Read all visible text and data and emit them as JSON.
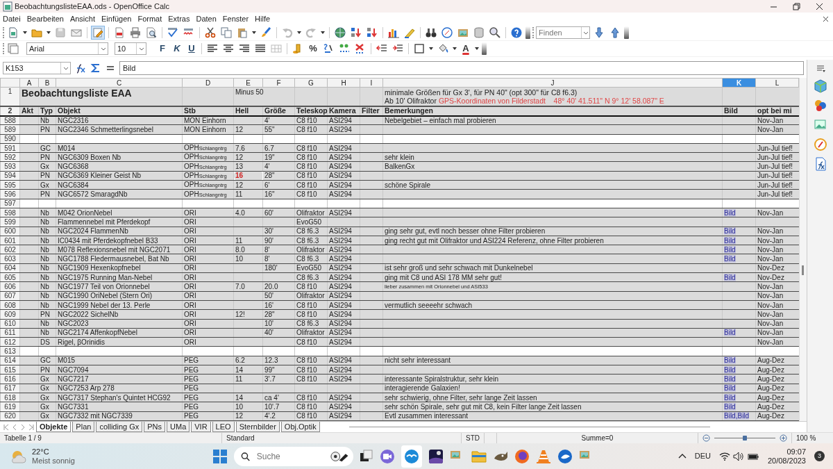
{
  "window": {
    "title": "BeobachtungslisteEAA.ods - OpenOffice Calc"
  },
  "menu": [
    "Datei",
    "Bearbeiten",
    "Ansicht",
    "Einfügen",
    "Format",
    "Extras",
    "Daten",
    "Fenster",
    "Hilfe"
  ],
  "toolbar": {
    "edit_mode": {
      "on": true
    },
    "find": {
      "placeholder": "Finden"
    }
  },
  "format_bar": {
    "font": "Arial",
    "size": "10",
    "text_buttons": [
      "F",
      "K",
      "U"
    ],
    "percent": "%",
    "font_color": "A"
  },
  "formula_bar": {
    "cell": "K153",
    "content": "Bild"
  },
  "columns": [
    {
      "label": "A",
      "selected": false
    },
    {
      "label": "B",
      "selected": false
    },
    {
      "label": "C",
      "selected": false
    },
    {
      "label": "D",
      "selected": false
    },
    {
      "label": "E",
      "selected": false
    },
    {
      "label": "F",
      "selected": false
    },
    {
      "label": "G",
      "selected": false
    },
    {
      "label": "H",
      "selected": false
    },
    {
      "label": "I",
      "selected": false
    },
    {
      "label": "J",
      "selected": false
    },
    {
      "label": "K",
      "selected": true
    },
    {
      "label": "L",
      "selected": false
    }
  ],
  "title_row": {
    "number": "1",
    "title": "Beobachtungsliste EAA",
    "e": "Minus 50",
    "j_lines": [
      [
        {
          "text": "minimale Größen für Gx 3', für PN 40\" (opt 300\" für C8 f6.3)",
          "color": "#222222"
        }
      ],
      [
        {
          "text": "Ab 10' Olifraktor",
          "color": "#222222"
        },
        {
          "text": "GPS-Koordinaten von Filderstadt    48° 40' 41.511\" N 9° 12' 58.087\" E",
          "color": "#e04545"
        }
      ]
    ]
  },
  "header_row": {
    "number": "2",
    "labels": [
      "Akt",
      "Typ",
      "Objekt",
      "Stb",
      "Hell",
      "Größe",
      "Teleskop",
      "Kamera",
      "Filter",
      "Bemerkungen",
      "Bild",
      "opt bei mi"
    ]
  },
  "rows": [
    {
      "number": "588",
      "kind": "data",
      "typ": "Nb",
      "objekt": "NGC2316",
      "stb": "MON Einhorn",
      "groesse": "4'",
      "teleskop": "C8 f10",
      "kamera": "ASI294",
      "bemerkung": "Nebelgebiet – einfach mal probieren",
      "opt": "Nov-Jan",
      "remark_small": false
    },
    {
      "number": "589",
      "kind": "data",
      "typ": "PN",
      "objekt": "NGC2346 Schmetterlingsnebel",
      "stb": "MON Einhorn",
      "hell": "12",
      "groesse": "55\"",
      "teleskop": "C8 f10",
      "kamera": "ASI294",
      "opt": "Nov-Jan",
      "hell_alert": false
    },
    {
      "number": "590",
      "kind": "blank"
    },
    {
      "number": "591",
      "kind": "data",
      "typ": "GC",
      "objekt": "M014",
      "stb": "OPH",
      "stb_sub": "Schlangntrg",
      "hell": "7.6",
      "groesse": "6.7",
      "teleskop": "C8 f10",
      "kamera": "ASI294",
      "opt": "Jun-Jul tief!",
      "hell_alert": false
    },
    {
      "number": "592",
      "kind": "data",
      "typ": "PN",
      "objekt": "NGC6309 Boxen Nb",
      "stb": "OPH",
      "stb_sub": "Schlangntrg",
      "hell": "12",
      "groesse": "19\"",
      "teleskop": "C8 f10",
      "kamera": "ASI294",
      "bemerkung": "sehr klein",
      "opt": "Jun-Jul tief!",
      "hell_alert": false,
      "remark_small": false
    },
    {
      "number": "593",
      "kind": "data",
      "typ": "Gx",
      "objekt": "NGC6368",
      "stb": "OPH",
      "stb_sub": "Schlangntrg",
      "hell": "13",
      "groesse": "4'",
      "teleskop": "C8 f10",
      "kamera": "ASI294",
      "bemerkung": "BalkenGx",
      "opt": "Jun-Jul tief!",
      "hell_alert": false,
      "remark_small": false
    },
    {
      "number": "594",
      "kind": "data",
      "typ": "PN",
      "objekt": "NGC6369 Kleiner Geist Nb",
      "stb": "OPH",
      "stb_sub": "Schlangntrg",
      "hell": "16",
      "groesse": "28\"",
      "teleskop": "C8 f10",
      "kamera": "ASI294",
      "opt": "Jun-Jul tief!",
      "hell_alert": true
    },
    {
      "number": "595",
      "kind": "data",
      "typ": "Gx",
      "objekt": "NGC6384",
      "stb": "OPH",
      "stb_sub": "Schlangntrg",
      "hell": "12",
      "groesse": "6'",
      "teleskop": "C8 f10",
      "kamera": "ASI294",
      "bemerkung": "schöne Spirale",
      "opt": "Jun-Jul tief!",
      "hell_alert": false,
      "remark_small": false
    },
    {
      "number": "596",
      "kind": "data",
      "typ": "PN",
      "objekt": "NGC6572 SmaragdNb",
      "stb": "OPH",
      "stb_sub": "Schlangntrg",
      "hell": "11",
      "groesse": "16\"",
      "teleskop": "C8 f10",
      "kamera": "ASI294",
      "opt": "Jun-Jul tief!",
      "hell_alert": false
    },
    {
      "number": "597",
      "kind": "blank"
    },
    {
      "number": "598",
      "kind": "data",
      "typ": "Nb",
      "objekt": "M042 OrionNebel",
      "stb": "ORI",
      "hell": "4.0",
      "groesse": "60'",
      "teleskop": "Olifraktor",
      "kamera": "ASI294",
      "bild": [
        "Bild"
      ],
      "opt": "Nov-Jan",
      "hell_alert": false
    },
    {
      "number": "599",
      "kind": "data",
      "typ": "Nb",
      "objekt": "Flammennebel mit Pferdekopf",
      "stb": "ORI",
      "teleskop": "EvoG50"
    },
    {
      "number": "600",
      "kind": "data",
      "typ": "Nb",
      "objekt": "NGC2024 FlammenNb",
      "stb": "ORI",
      "groesse": "30'",
      "teleskop": "C8 f6.3",
      "kamera": "ASI294",
      "bemerkung": "ging sehr gut, evtl noch besser ohne Filter probieren",
      "bild": [
        "Bild"
      ],
      "opt": "Nov-Jan",
      "remark_small": false
    },
    {
      "number": "601",
      "kind": "data",
      "typ": "Nb",
      "objekt": "IC0434 mit Pferdekopfnebel B33",
      "stb": "ORI",
      "hell": "11",
      "groesse": "90'",
      "teleskop": "C8 f6.3",
      "kamera": "ASI294",
      "bemerkung": "ging recht gut mit Olifraktor und ASI224 Referenz, ohne Filter probieren",
      "bild": [
        "Bild"
      ],
      "opt": "Nov-Jan",
      "hell_alert": false,
      "remark_small": false
    },
    {
      "number": "602",
      "kind": "data",
      "typ": "Nb",
      "objekt": "M078 Reflexionsnebel mit NGC2071",
      "stb": "ORI",
      "hell": "8.0",
      "groesse": "8'",
      "teleskop": "Olifraktor",
      "kamera": "ASI294",
      "bild": [
        "Bild"
      ],
      "opt": "Nov-Jan",
      "hell_alert": false
    },
    {
      "number": "603",
      "kind": "data",
      "typ": "Nb",
      "objekt": "NGC1788 Fledermausnebel, Bat Nb",
      "stb": "ORI",
      "hell": "10",
      "groesse": "8'",
      "teleskop": "C8 f6.3",
      "kamera": "ASI294",
      "bild": [
        "Bild"
      ],
      "opt": "Nov-Jan",
      "hell_alert": false
    },
    {
      "number": "604",
      "kind": "data",
      "typ": "Nb",
      "objekt": "NGC1909 Hexenkopfnebel",
      "stb": "ORI",
      "groesse": "180'",
      "teleskop": "EvoG50",
      "kamera": "ASI294",
      "bemerkung": "ist sehr groß und sehr schwach mit Dunkelnebel",
      "opt": "Nov-Dez",
      "remark_small": false
    },
    {
      "number": "605",
      "kind": "data",
      "typ": "Nb",
      "objekt": "NGC1975 Running Man-Nebel",
      "stb": "ORI",
      "teleskop": "C8 f6.3",
      "kamera": "ASI294",
      "bemerkung": "ging mit C8 und ASI 178 MM sehr gut!",
      "bild": [
        "Bild"
      ],
      "opt": "Nov-Dez",
      "remark_small": false
    },
    {
      "number": "606",
      "kind": "data",
      "typ": "Nb",
      "objekt": "NGC1977 Teil von Orionnebel",
      "stb": "ORI",
      "hell": "7.0",
      "groesse": "20.0",
      "teleskop": "C8 f10",
      "kamera": "ASI294",
      "bemerkung": "lieber zusammen mit Orionnebel und ASI533",
      "opt": "Nov-Jan",
      "hell_alert": false,
      "remark_small": true
    },
    {
      "number": "607",
      "kind": "data",
      "typ": "Nb",
      "objekt": "NGC1990 OriNebel (Stern Ori)",
      "stb": "ORI",
      "groesse": "50'",
      "teleskop": "Olifraktor",
      "kamera": "ASI294",
      "opt": "Nov-Jan"
    },
    {
      "number": "608",
      "kind": "data",
      "typ": "Nb",
      "objekt": "NGC1999 Nebel der 13. Perle",
      "stb": "ORI",
      "groesse": "16'",
      "teleskop": "C8 f10",
      "kamera": "ASI294",
      "bemerkung": "vermutlich seeeehr schwach",
      "opt": "Nov-Jan",
      "remark_small": false
    },
    {
      "number": "609",
      "kind": "data",
      "typ": "PN",
      "objekt": "NGC2022 SichelNb",
      "stb": "ORI",
      "hell": "12!",
      "groesse": "28\"",
      "teleskop": "C8 f10",
      "kamera": "ASI294",
      "opt": "Nov-Jan",
      "hell_alert": false
    },
    {
      "number": "610",
      "kind": "data",
      "typ": "Nb",
      "objekt": "NGC2023",
      "stb": "ORI",
      "groesse": "10'",
      "teleskop": "C8 f6.3",
      "kamera": "ASI294",
      "opt": "Nov-Jan"
    },
    {
      "number": "611",
      "kind": "data",
      "typ": "Nb",
      "objekt": "NGC2174 AffenkopfNebel",
      "stb": "ORI",
      "groesse": "40'",
      "teleskop": "Olifraktor",
      "kamera": "ASI294",
      "bild": [
        "Bild"
      ],
      "opt": "Nov-Jan"
    },
    {
      "number": "612",
      "kind": "data",
      "typ": "DS",
      "objekt": "Rigel, βOrinidis",
      "stb": "ORI",
      "teleskop": "C8 f10",
      "kamera": "ASI294",
      "opt": "Nov-Jan"
    },
    {
      "number": "613",
      "kind": "blank"
    },
    {
      "number": "614",
      "kind": "data",
      "typ": "GC",
      "objekt": "M015",
      "stb": "PEG",
      "hell": "6.2",
      "groesse": "12.3",
      "teleskop": "C8 f10",
      "kamera": "ASI294",
      "bemerkung": "nicht sehr interessant",
      "bild": [
        "Bild"
      ],
      "opt": "Aug-Dez",
      "hell_alert": false,
      "remark_small": false
    },
    {
      "number": "615",
      "kind": "data",
      "typ": "PN",
      "objekt": "NGC7094",
      "stb": "PEG",
      "hell": "14",
      "groesse": "99\"",
      "teleskop": "C8 f10",
      "kamera": "ASI294",
      "bild": [
        "Bild"
      ],
      "opt": "Aug-Dez",
      "hell_alert": false
    },
    {
      "number": "616",
      "kind": "data",
      "typ": "Gx",
      "objekt": "NGC7217",
      "stb": "PEG",
      "hell": "11",
      "groesse": "3'.7",
      "teleskop": "C8 f10",
      "kamera": "ASI294",
      "bemerkung": "interessante Spiralstruktur, sehr klein",
      "bild": [
        "Bild"
      ],
      "opt": "Aug-Dez",
      "hell_alert": false,
      "remark_small": false
    },
    {
      "number": "617",
      "kind": "data",
      "typ": "Gx",
      "objekt": "NGC7253 Arp 278",
      "stb": "PEG",
      "bemerkung": "interagierende Galaxien!",
      "bild": [
        "Bild"
      ],
      "opt": "Aug-Dez",
      "remark_small": false
    },
    {
      "number": "618",
      "kind": "data",
      "typ": "Gx",
      "objekt": "NGC7317 Stephan's Quintet HCG92",
      "stb": "PEG",
      "hell": "14",
      "groesse": "ca 4'",
      "teleskop": "C8 f10",
      "kamera": "ASI294",
      "bemerkung": "sehr schwierig, ohne Filter, sehr lange Zeit lassen",
      "bild": [
        "Bild"
      ],
      "opt": "Aug-Dez",
      "hell_alert": false,
      "remark_small": false
    },
    {
      "number": "619",
      "kind": "data",
      "typ": "Gx",
      "objekt": "NGC7331",
      "stb": "PEG",
      "hell": "10",
      "groesse": "10'.7",
      "teleskop": "C8 f10",
      "kamera": "ASI294",
      "bemerkung": "sehr schön Spirale, sehr gut mit C8, kein Filter lange Zeit lassen",
      "bild": [
        "Bild"
      ],
      "opt": "Aug-Dez",
      "hell_alert": false,
      "remark_small": false
    },
    {
      "number": "620",
      "kind": "data",
      "typ": "Gx",
      "objekt": "NGC7332 mit NGC7339",
      "stb": "PEG",
      "hell": "12",
      "groesse": "4'.2",
      "teleskop": "C8 f10",
      "kamera": "ASI294",
      "bemerkung": "Evtl zusammen interessant",
      "bild": [
        "Bild",
        ",",
        "Bild"
      ],
      "opt": "Aug-Dez",
      "hell_alert": false,
      "remark_small": false
    }
  ],
  "sheet_tabs": [
    {
      "label": "Objekte",
      "selected": true
    },
    {
      "label": "Plan",
      "selected": false
    },
    {
      "label": "colliding Gx",
      "selected": false
    },
    {
      "label": "PNs",
      "selected": false
    },
    {
      "label": "UMa",
      "selected": false
    },
    {
      "label": "VIR",
      "selected": false
    },
    {
      "label": "LEO",
      "selected": false
    },
    {
      "label": "Sternbilder",
      "selected": false
    },
    {
      "label": "Obj.Optik",
      "selected": false
    }
  ],
  "status_bar": {
    "sheet": "Tabelle 1 / 9",
    "style": "Standard",
    "mode": "STD",
    "sum": "Summe=0",
    "zoom": {
      "level": 0.5,
      "reading": "100 %"
    }
  },
  "taskbar": {
    "temperature": "22°C",
    "weather": "Meist sonnig",
    "search": {
      "placeholder": "Suche"
    },
    "language": "DEU",
    "time": "09:07",
    "date": "20/08/2023",
    "notifications": "3"
  }
}
